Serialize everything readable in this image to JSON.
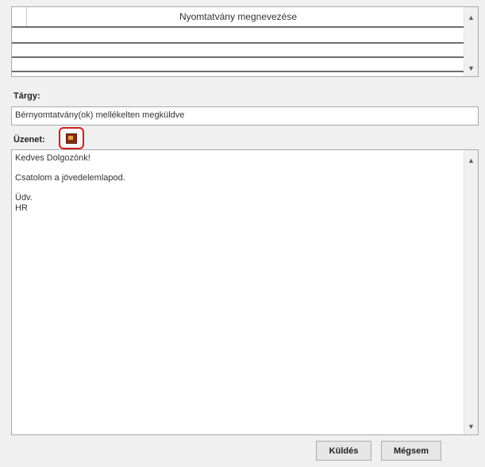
{
  "form_list": {
    "column_header": "Nyomtatvány megnevezése",
    "scroll_up_icon": "chevron-up-icon",
    "scroll_down_icon": "chevron-down-icon"
  },
  "subject": {
    "label": "Tárgy:",
    "value": "Bérnyomtatvány(ok) mellékelten megküldve"
  },
  "message": {
    "label": "Üzenet:",
    "attach_icon": "attachment-icon",
    "lines": [
      "Kedves Dolgozónk!",
      "",
      "Csatolom a jövedelemlapod.",
      "",
      "Üdv.",
      "HR"
    ],
    "scroll_up_icon": "chevron-up-icon",
    "scroll_down_icon": "chevron-down-icon"
  },
  "buttons": {
    "send_label": "Küldés",
    "cancel_label": "Mégsem"
  },
  "colors": {
    "highlight": "#d41d1d"
  }
}
